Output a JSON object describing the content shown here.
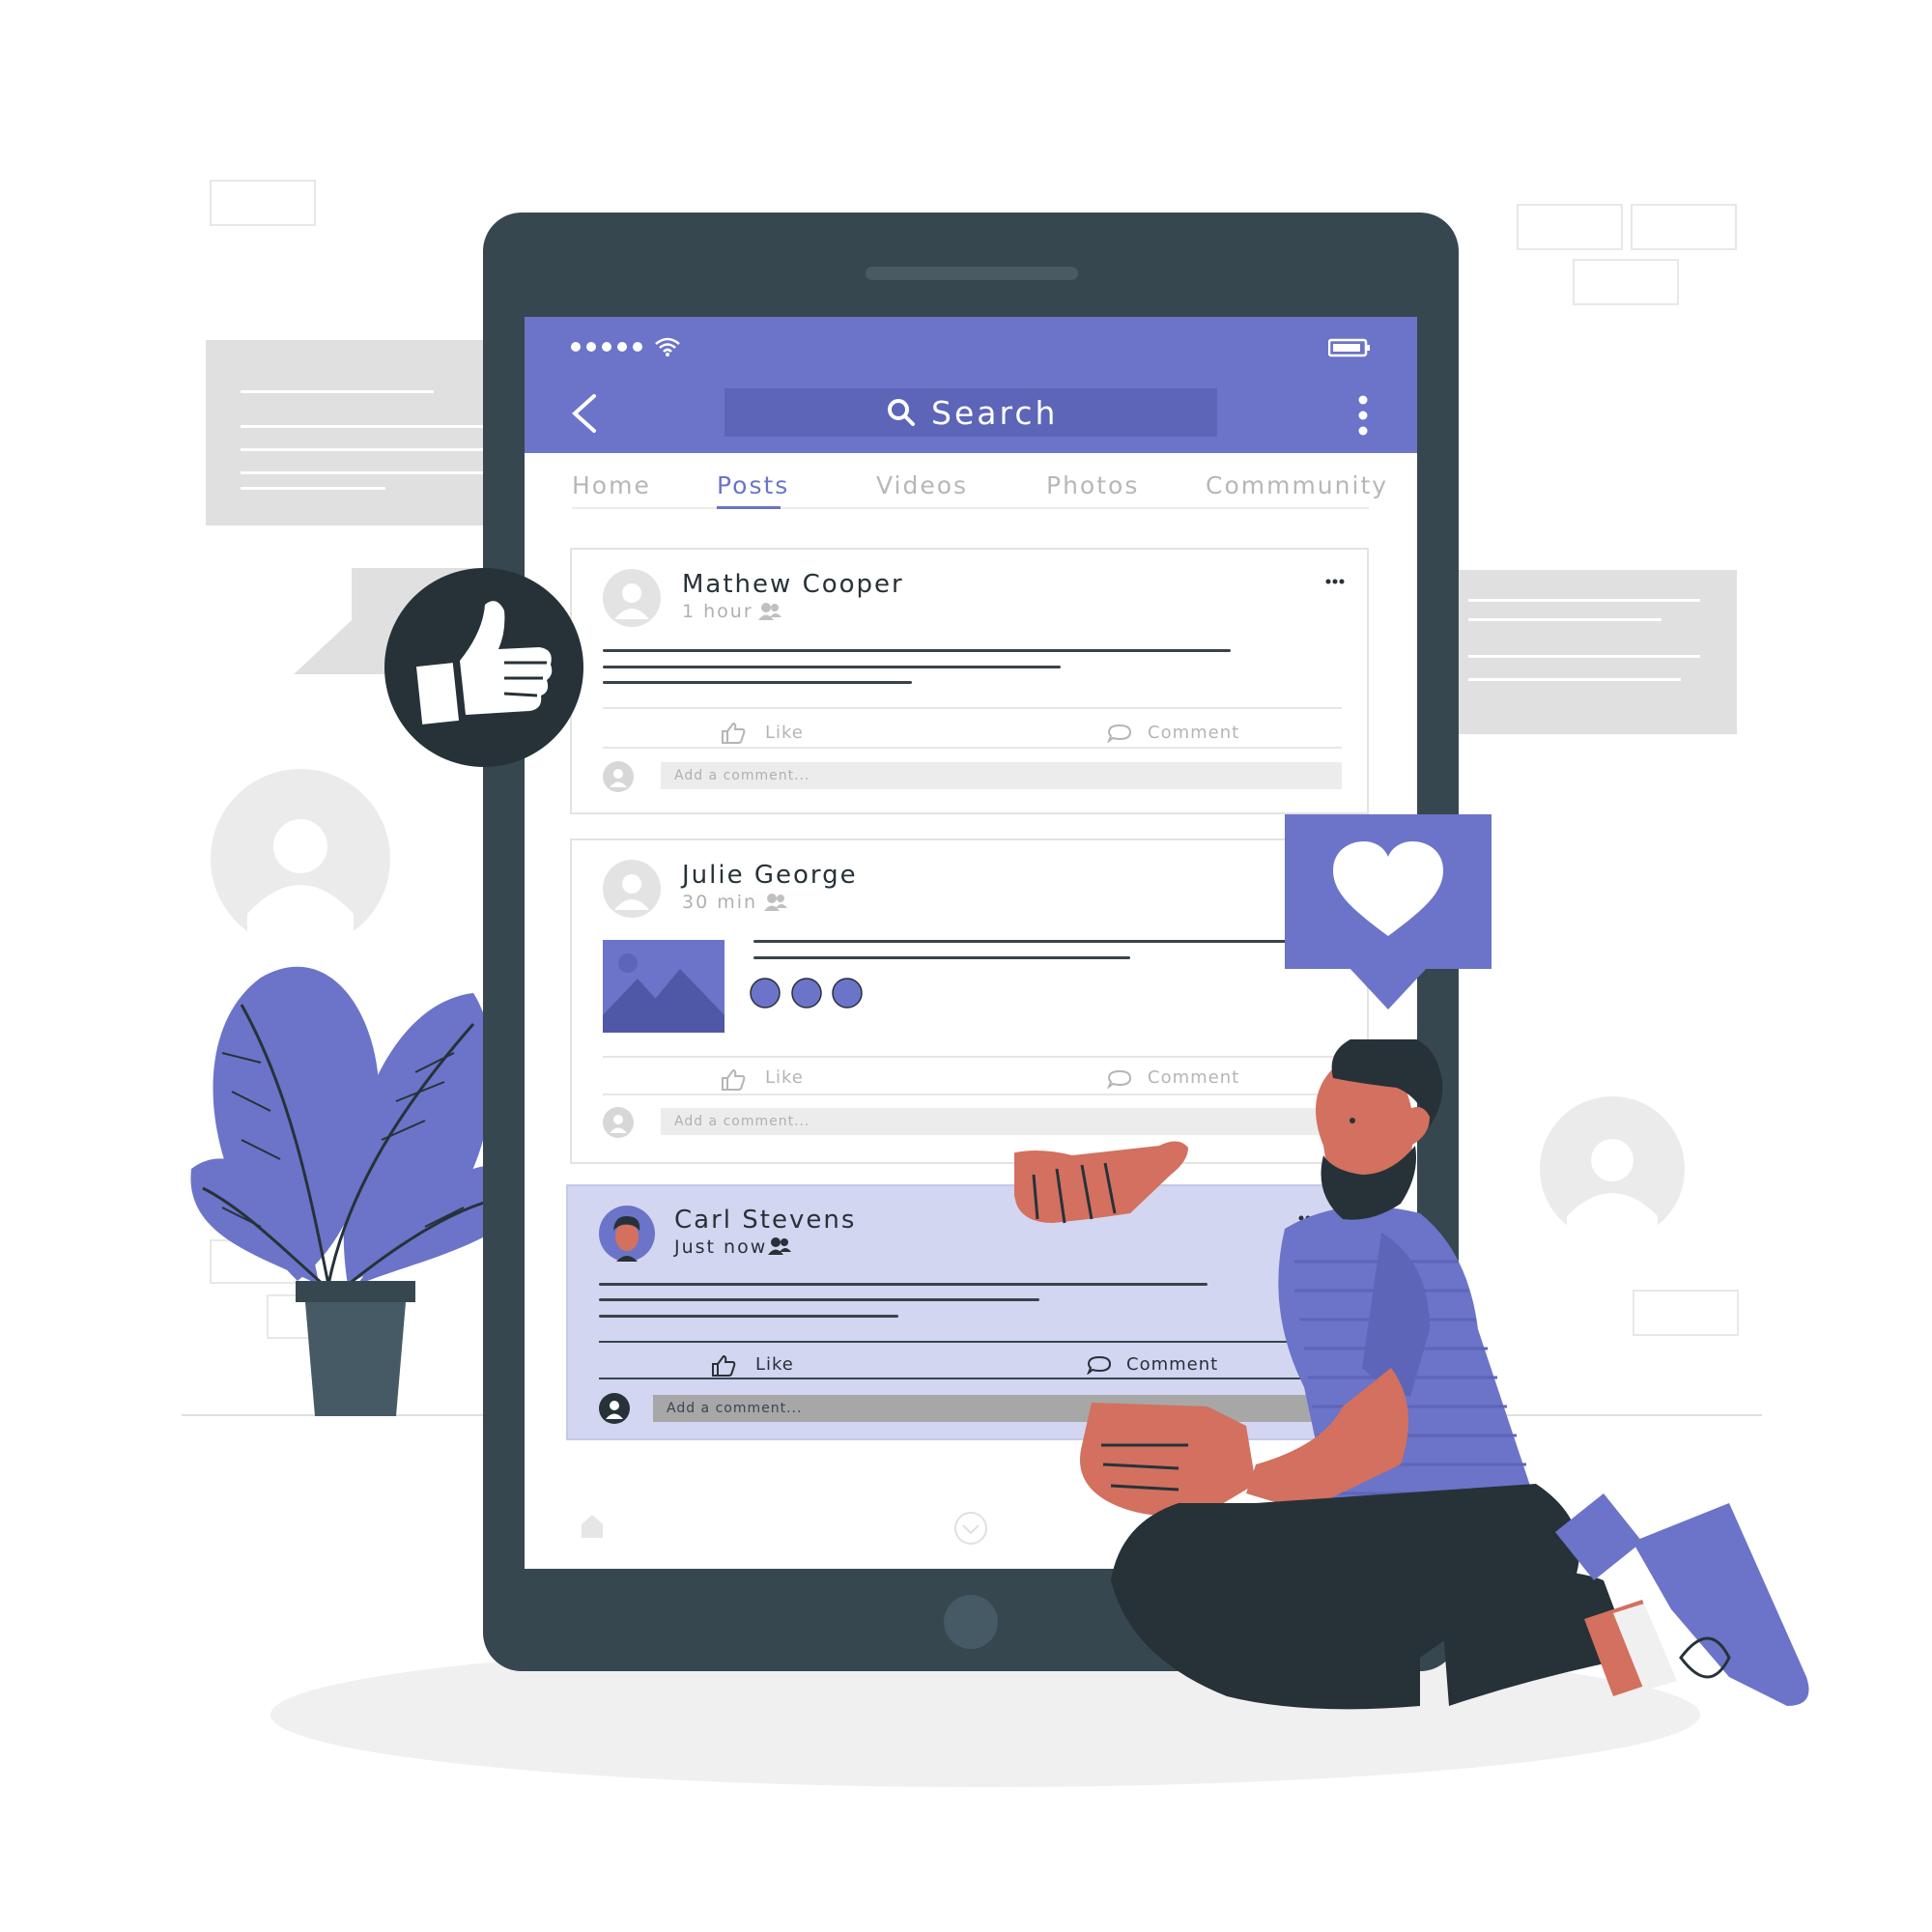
{
  "colors": {
    "primary": "#6b74c8",
    "primary_dark": "#5c65b8",
    "device": "#37474f",
    "dark": "#263238",
    "skin": "#d3705f",
    "highlight_card": "#d3d6f0",
    "light_gray": "#e0e0e0"
  },
  "status_bar": {
    "signal_icon": "signal-dots-icon",
    "wifi_icon": "wifi-icon",
    "battery_icon": "battery-icon"
  },
  "header": {
    "back_icon": "chevron-left-icon",
    "search_icon": "search-icon",
    "search_label": "Search",
    "menu_icon": "vertical-dots-icon"
  },
  "tabs": [
    {
      "label": "Home",
      "active": false
    },
    {
      "label": "Posts",
      "active": true
    },
    {
      "label": "Videos",
      "active": false
    },
    {
      "label": "Photos",
      "active": false
    },
    {
      "label": "Commmunity",
      "active": false
    }
  ],
  "posts": [
    {
      "author": "Mathew Cooper",
      "time": "1 hour",
      "like_label": "Like",
      "comment_label": "Comment",
      "comment_placeholder": "Add a comment..."
    },
    {
      "author": "Julie George",
      "time": "30 min",
      "like_label": "Like",
      "comment_label": "Comment",
      "comment_placeholder": "Add a comment..."
    },
    {
      "author": "Carl Stevens",
      "time": "Just now",
      "like_label": "Like",
      "comment_label": "Comment",
      "comment_placeholder": "Add a comment..."
    }
  ],
  "bottom_nav": {
    "home_icon": "home-icon",
    "down_icon": "chevron-down-circle-icon"
  },
  "floating": {
    "like_badge_icon": "thumbs-up-icon",
    "heart_badge_icon": "heart-icon"
  }
}
